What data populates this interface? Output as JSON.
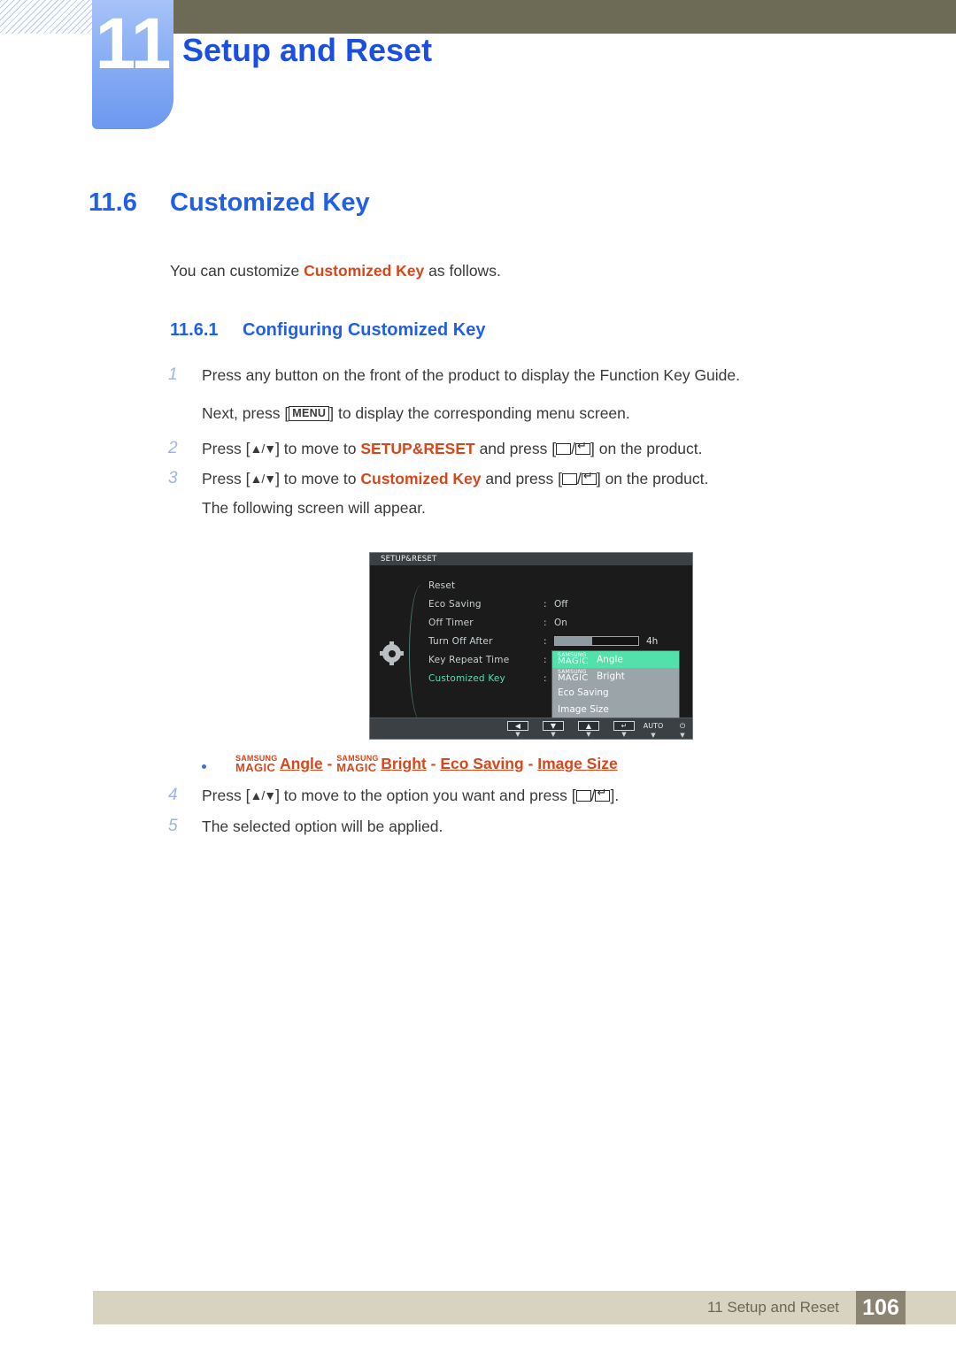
{
  "chapter": {
    "number": "11",
    "title": "Setup and Reset"
  },
  "section": {
    "number": "11.6",
    "title": "Customized Key",
    "intro_before": "You can customize ",
    "intro_highlight": "Customized Key",
    "intro_after": " as follows."
  },
  "subsection": {
    "number": "11.6.1",
    "title": "Configuring Customized Key"
  },
  "steps": [
    {
      "n": "1",
      "pre": "Press any button on the front of the product to display the Function Key Guide."
    },
    {
      "n": "2",
      "a": "Press [",
      "keys": "▲/▼",
      "b": "] to move to ",
      "highlight": "SETUP&RESET",
      "c": " and press [",
      "d": "/",
      "e": "] on the product."
    },
    {
      "n": "3",
      "a": "Press [",
      "keys": "▲/▼",
      "b": "] to move to ",
      "highlight": "Customized Key",
      "c": " and press [",
      "d": "/",
      "e": "] on the product."
    },
    {
      "n": "4",
      "a": "Press [",
      "keys": "▲/▼",
      "b": "] to move to the option you want and press [",
      "d": "/",
      "e": "]."
    },
    {
      "n": "5",
      "pre": "The selected option will be applied."
    }
  ],
  "step1_cont": {
    "a": "Next, press [",
    "key": "MENU",
    "b": "] to display the corresponding menu screen."
  },
  "step3_cont": "The following screen will appear.",
  "osd": {
    "title": "SETUP&RESET",
    "rows": [
      {
        "label": "Reset",
        "colon": "",
        "value": ""
      },
      {
        "label": "Eco Saving",
        "colon": ":",
        "value": "Off"
      },
      {
        "label": "Off Timer",
        "colon": ":",
        "value": "On"
      },
      {
        "label": "Turn Off After",
        "colon": ":",
        "value": "",
        "bar": 45,
        "bar_label": "4h"
      },
      {
        "label": "Key Repeat Time",
        "colon": ":",
        "value": ""
      },
      {
        "label": "Customized Key",
        "colon": ":",
        "value": "",
        "selected": true
      }
    ],
    "dropdown": [
      {
        "brand": "SAMSUNG",
        "magic": "MAGIC",
        "label": "Angle",
        "highlighted": true
      },
      {
        "brand": "SAMSUNG",
        "magic": "MAGIC",
        "label": "Bright",
        "highlighted": false
      },
      {
        "brand": "",
        "magic": "",
        "label": "Eco Saving",
        "highlighted": false
      },
      {
        "brand": "",
        "magic": "",
        "label": "Image Size",
        "highlighted": false
      }
    ],
    "footer_buttons": [
      {
        "glyph": "◀",
        "type": "cap"
      },
      {
        "glyph": "▼",
        "type": "cap"
      },
      {
        "glyph": "▲",
        "type": "cap"
      },
      {
        "glyph": "↵",
        "type": "cap"
      },
      {
        "glyph": "AUTO",
        "type": "txt"
      },
      {
        "glyph": "⏻",
        "type": "txt"
      }
    ],
    "colors": {
      "background": "#1b1b1b",
      "title_bar": "#3b4044",
      "highlight": "#52e0ab",
      "dropdown_bg": "#9aa4a9",
      "text": "#c9cfd2"
    }
  },
  "bullet": {
    "options": [
      {
        "brand": "SAMSUNG",
        "magic": "MAGIC",
        "label": "Angle"
      },
      {
        "brand": "SAMSUNG",
        "magic": "MAGIC",
        "label": "Bright"
      },
      {
        "brand": "",
        "magic": "",
        "label": "Eco Saving"
      },
      {
        "brand": "",
        "magic": "",
        "label": "Image Size"
      }
    ],
    "separator": "-"
  },
  "footer": {
    "text": "11 Setup and Reset",
    "page": "106"
  },
  "colors": {
    "heading_blue": "#2060e8",
    "accent_orange": "#d9461a",
    "olive": "#6d6b55",
    "footer_beige": "#d8d3c0",
    "footer_page_box": "#8c8472",
    "tab_blue": "#8cb0f4"
  }
}
